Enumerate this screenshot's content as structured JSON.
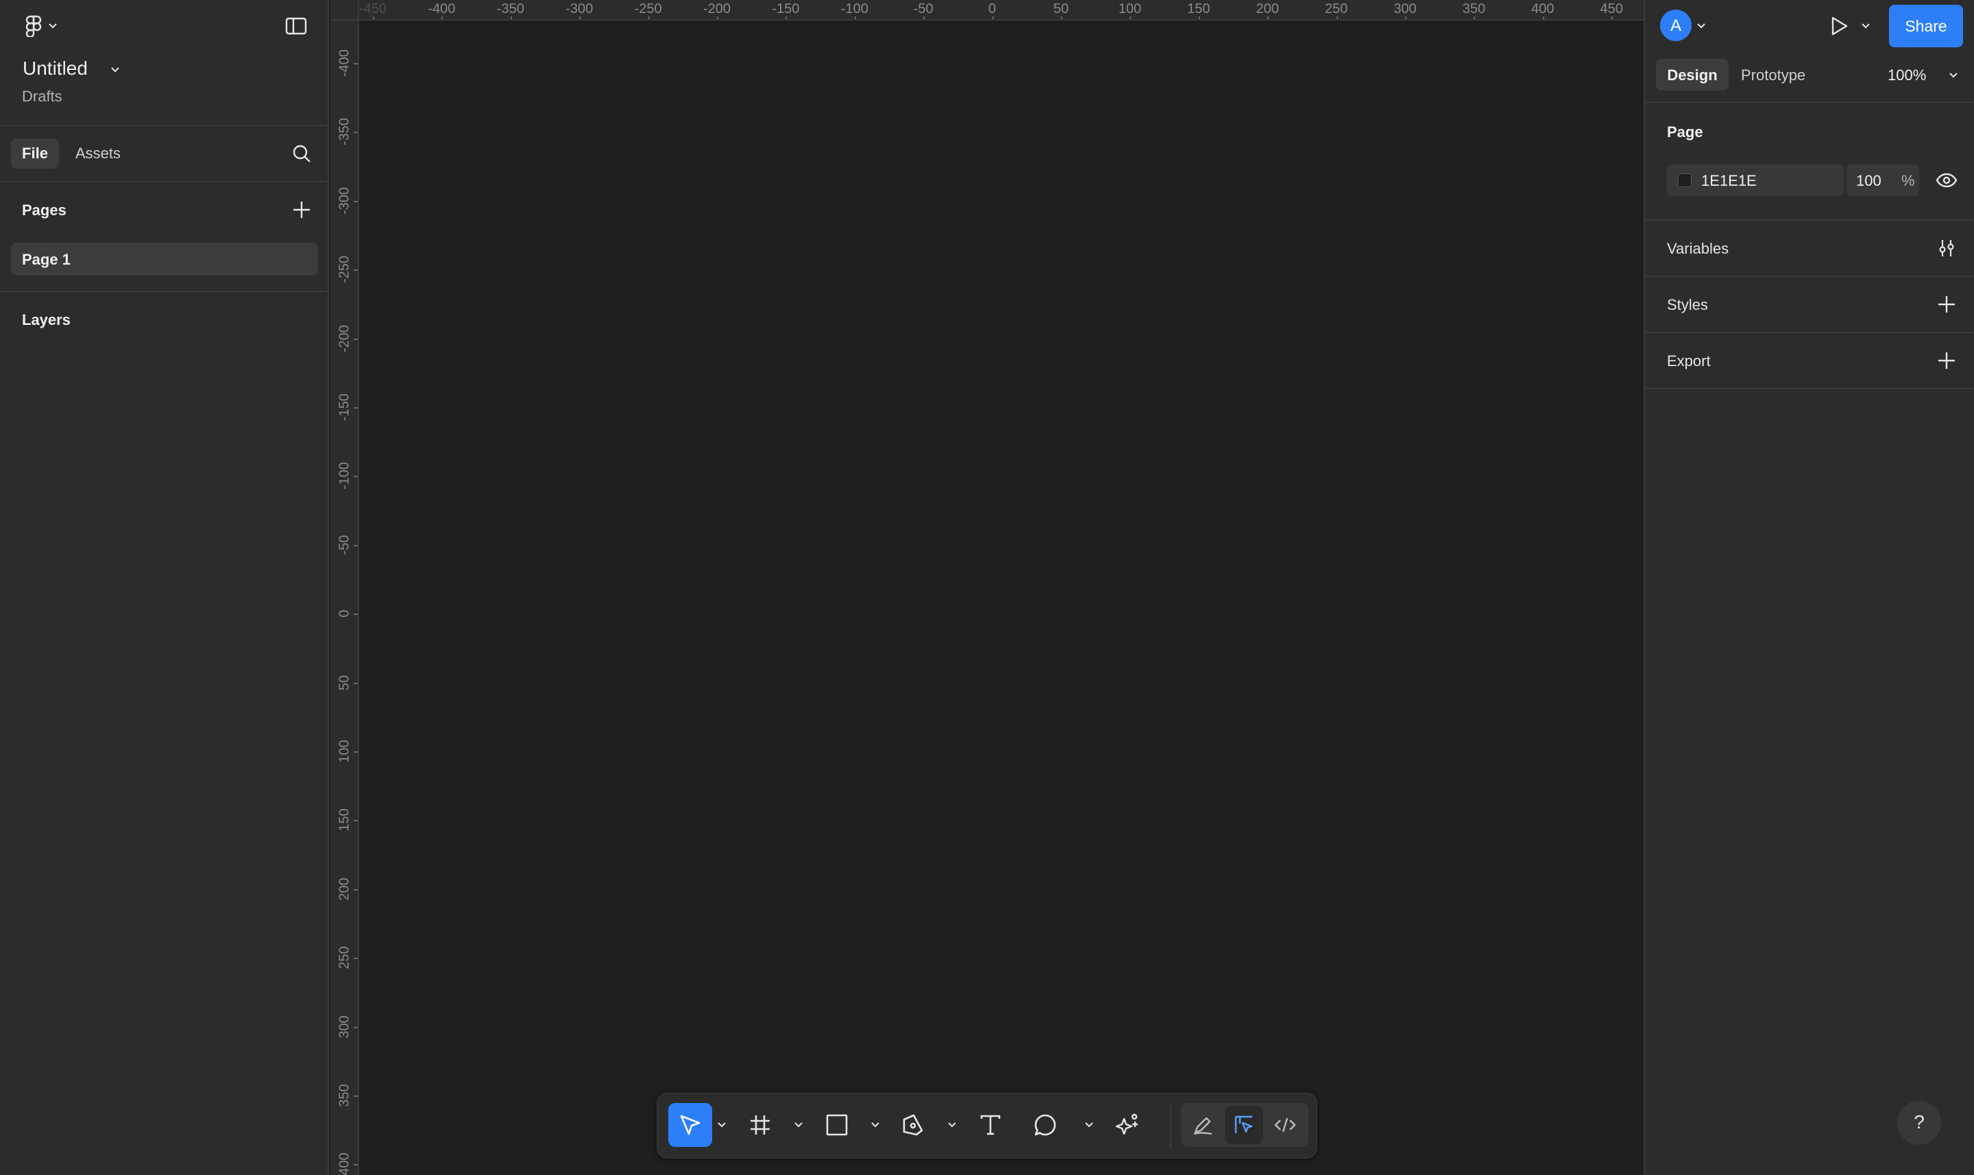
{
  "file": {
    "title": "Untitled",
    "location": "Drafts"
  },
  "left_tabs": {
    "file": "File",
    "assets": "Assets"
  },
  "pages": {
    "heading": "Pages",
    "items": [
      "Page 1"
    ]
  },
  "layers": {
    "heading": "Layers"
  },
  "header": {
    "avatar_initial": "A",
    "share_label": "Share"
  },
  "right_tabs": {
    "design": "Design",
    "prototype": "Prototype",
    "zoom": "100%"
  },
  "page_panel": {
    "heading": "Page",
    "color_hex": "1E1E1E",
    "opacity": "100",
    "percent_sign": "%"
  },
  "sections": {
    "variables": "Variables",
    "styles": "Styles",
    "export": "Export"
  },
  "help": {
    "label": "?"
  },
  "ruler_top": [
    "-450",
    "-400",
    "-350",
    "-300",
    "-250",
    "-200",
    "-150",
    "-100",
    "-50",
    "0",
    "50",
    "100",
    "150",
    "200",
    "250",
    "300",
    "350",
    "400",
    "450"
  ],
  "ruler_left": [
    "-400",
    "-350",
    "-300",
    "-250",
    "-200",
    "-150",
    "-100",
    "-50",
    "0",
    "50",
    "100",
    "150",
    "200",
    "250",
    "300",
    "350",
    "400"
  ],
  "colors": {
    "accent": "#2d7ff9",
    "canvas": "#1e1e1e",
    "panel": "#2c2c2c",
    "swatch": "#1E1E1E"
  },
  "toolbar": {
    "tools": [
      "move-tool",
      "frame-tool",
      "rectangle-tool",
      "pen-tool",
      "text-tool",
      "comment-tool",
      "actions-tool"
    ],
    "modes": [
      "draw-mode",
      "design-mode",
      "dev-mode"
    ],
    "active_tool": "move-tool",
    "active_mode": "design-mode"
  }
}
